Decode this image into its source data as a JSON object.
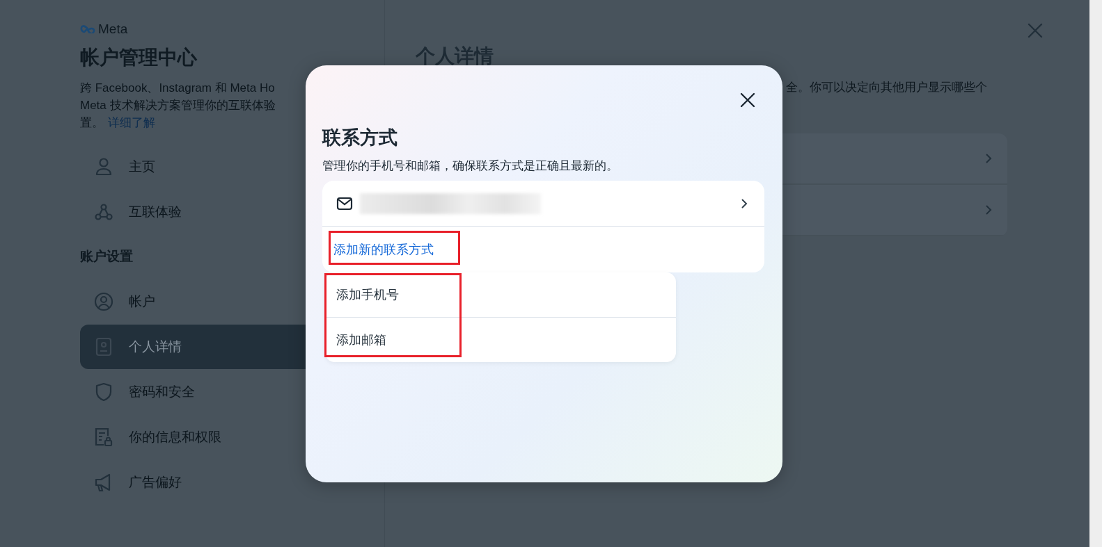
{
  "sidebar": {
    "brand": "Meta",
    "title": "帐户管理中心",
    "description_lines": [
      "跨 Facebook、Instagram 和 Meta Ho",
      "Meta 技术解决方案管理你的互联体验"
    ],
    "description_end": "置。",
    "learn_more": "详细了解",
    "items": [
      {
        "kind": "nav",
        "label": "主页",
        "selected": false
      },
      {
        "kind": "nav",
        "label": "互联体验",
        "selected": false
      },
      {
        "kind": "section",
        "label": "账户设置"
      },
      {
        "kind": "nav",
        "label": "帐户",
        "selected": false
      },
      {
        "kind": "nav",
        "label": "个人详情",
        "selected": true
      },
      {
        "kind": "nav",
        "label": "密码和安全",
        "selected": false
      },
      {
        "kind": "nav",
        "label": "你的信息和权限",
        "selected": false
      },
      {
        "kind": "nav",
        "label": "广告偏好",
        "selected": false
      }
    ]
  },
  "main": {
    "title": "个人详情",
    "description": "全。你可以决定向其他用户显示哪些个"
  },
  "dialog": {
    "title": "联系方式",
    "subtitle": "管理你的手机号和邮箱，确保联系方式是正确且最新的。",
    "contacts": [
      {
        "kind": "email",
        "redacted": true
      }
    ],
    "add_link": {
      "label": "添加新的联系方式",
      "highlighted": true
    },
    "menu": {
      "highlighted": true,
      "items": [
        {
          "label": "添加手机号"
        },
        {
          "label": "添加邮箱"
        }
      ]
    }
  }
}
